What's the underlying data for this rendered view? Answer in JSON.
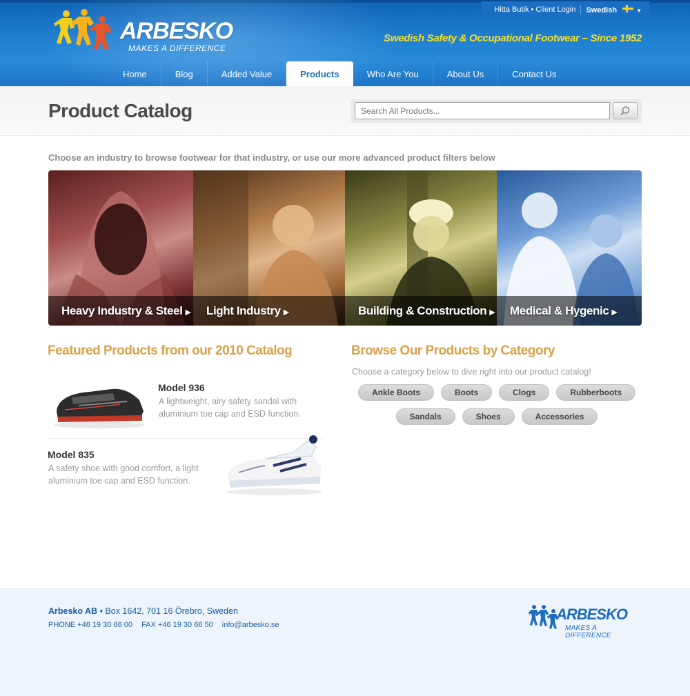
{
  "header": {
    "logo": {
      "word": "ARBESKO",
      "tagline": "MAKES A DIFFERENCE"
    },
    "toplinks": {
      "store": "Hitta Butik",
      "login": "Client Login",
      "language": "Swedish"
    },
    "slogan": "Swedish Safety & Occupational Footwear – Since 1952",
    "nav": [
      {
        "label": "Home"
      },
      {
        "label": "Blog"
      },
      {
        "label": "Added Value"
      },
      {
        "label": "Products",
        "active": true
      },
      {
        "label": "Who Are You"
      },
      {
        "label": "About Us"
      },
      {
        "label": "Contact Us"
      }
    ]
  },
  "titlebar": {
    "title": "Product Catalog",
    "search_placeholder": "Search All Products...",
    "search_icon": "magnifier-icon"
  },
  "intro": "Choose an industry to browse footwear for that industry, or use our more advanced product filters below",
  "industries": [
    {
      "label": "Heavy Industry & Steel"
    },
    {
      "label": "Light Industry"
    },
    {
      "label": "Building & Construction"
    },
    {
      "label": "Medical & Hygenic"
    }
  ],
  "featured": {
    "title": "Featured Products from our 2010 Catalog",
    "products": [
      {
        "name": "Model 936",
        "description": "A lightweight, airy safety sandal with aluminium toe cap and ESD function."
      },
      {
        "name": "Model 835",
        "description": "A safety shoe with good comfort, a light aluminium toe cap and ESD function."
      }
    ]
  },
  "browse": {
    "title": "Browse Our Products by Category",
    "intro": "Choose a category below to dive right into our product catalog!",
    "categories": [
      "Ankle Boots",
      "Boots",
      "Clogs",
      "Rubberboots",
      "Sandals",
      "Shoes",
      "Accessories"
    ]
  },
  "footer": {
    "company": "Arbesko AB",
    "address": "Box 1642, 701 16 Örebro, Sweden",
    "phone": "PHONE +46 19 30 66 00",
    "fax": "FAX +46 19 30 66 50",
    "email": "info@arbesko.se",
    "logo_word": "ARBESKO",
    "logo_tag": "MAKES A DIFFERENCE"
  },
  "colors": {
    "header_blue": "#1f7fd1",
    "slogan_yellow": "#f6e02a",
    "heading_orange": "#d9a14a",
    "footer_blue": "#1c5fa6"
  }
}
